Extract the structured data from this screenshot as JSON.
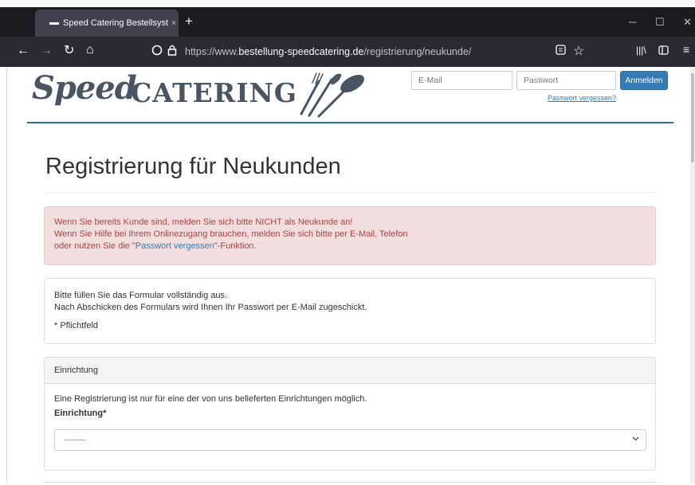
{
  "browser": {
    "tab_title": "Speed Catering Bestellsystem",
    "tab_close": "×",
    "new_tab": "+",
    "url_prefix": "https://www.",
    "url_domain": "bestellung-speedcatering.de",
    "url_path": "/registrierung/neukunde/",
    "icons": [
      "back-icon",
      "forward-icon",
      "reload-icon",
      "home-icon",
      "shield-icon",
      "lock-icon",
      "reader-view-icon",
      "bookmark-star-icon",
      "library-icon",
      "sidebar-icon",
      "menu-icon",
      "minimize-icon",
      "maximize-icon",
      "close-icon"
    ]
  },
  "header": {
    "logo_speed": "Speed",
    "logo_catering": "CATERING",
    "email_placeholder": "E-Mail",
    "password_placeholder": "Passwort",
    "login_label": "Anmelden",
    "forgot_label": "Passwort vergessen?",
    "accent": "#2e6ea2"
  },
  "main": {
    "title": "Registrierung für Neukunden",
    "alert": {
      "line1": "Wenn Sie bereits Kunde sind, melden Sie sich bitte NICHT als Neukunde an!",
      "line2": "Wenn Sie Hilfe bei Ihrem Onlinezugang brauchen, melden Sie sich bitte per E-Mail, Telefon",
      "line3_before": "oder nutzen Sie die \"",
      "line3_link": "Passwort vergessen",
      "line3_after": "\"-Funktion."
    },
    "info": {
      "line1": "Bitte füllen Sie das Formular vollständig aus.",
      "line2": "Nach Abschicken des Formulars wird Ihnen Ihr Passwort per E-Mail zugeschickt.",
      "required_note": "* Pflichtfeld"
    },
    "einrichtung_panel": {
      "heading": "Einrichtung",
      "text": "Eine Registrierung ist nur für eine der von uns belieferten Einrichtungen möglich.",
      "field_label": "Einrichtung*",
      "select_value": "---------"
    }
  }
}
